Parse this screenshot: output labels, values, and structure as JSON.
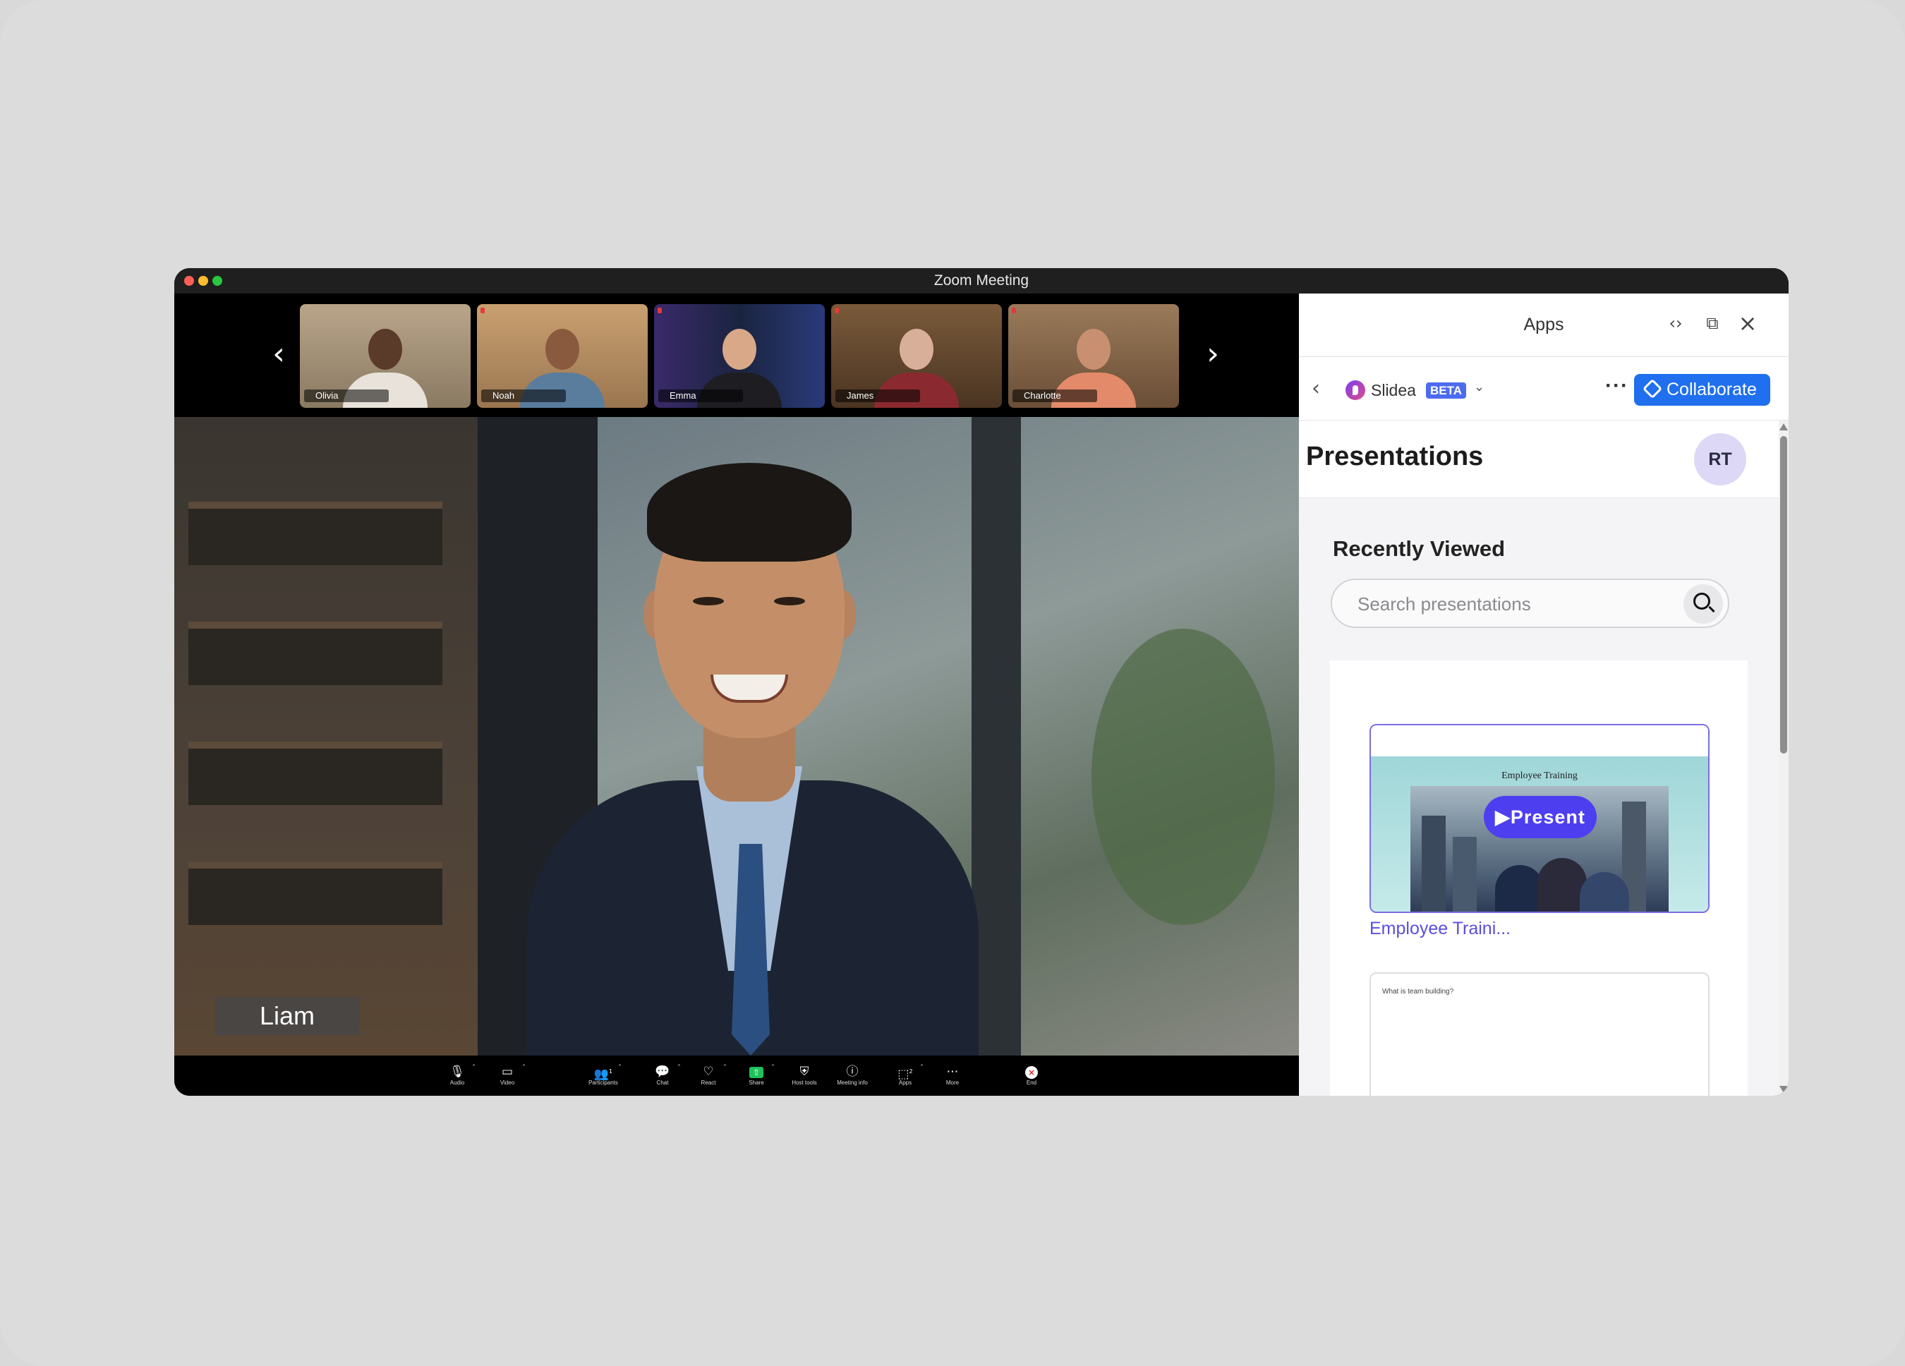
{
  "window": {
    "title": "Zoom Meeting"
  },
  "gallery": {
    "participants": [
      {
        "name": "Olivia"
      },
      {
        "name": "Noah"
      },
      {
        "name": "Emma"
      },
      {
        "name": "James"
      },
      {
        "name": "Charlotte"
      }
    ],
    "prev_icon": "chevron-left-icon",
    "next_icon": "chevron-right-icon"
  },
  "speaker": {
    "name": "Liam"
  },
  "toolbar": {
    "items": [
      {
        "label": "Audio",
        "icon": "microphone-icon"
      },
      {
        "label": "Video",
        "icon": "camera-icon"
      },
      {
        "label": "Participants",
        "icon": "participants-icon",
        "count": "1"
      },
      {
        "label": "Chat",
        "icon": "chat-icon"
      },
      {
        "label": "React",
        "icon": "heart-icon"
      },
      {
        "label": "Share",
        "icon": "share-icon"
      },
      {
        "label": "Host tools",
        "icon": "shield-icon"
      },
      {
        "label": "Meeting info",
        "icon": "info-icon"
      },
      {
        "label": "Apps",
        "icon": "apps-icon",
        "count": "2"
      },
      {
        "label": "More",
        "icon": "more-icon"
      },
      {
        "label": "End",
        "icon": "end-icon"
      }
    ],
    "colors": {
      "share": "#1fc35a",
      "end": "#e0282e"
    }
  },
  "apps_panel": {
    "title": "Apps",
    "app_name": "Slidea",
    "badge": "BETA",
    "collaborate_label": "Collaborate",
    "section_title": "Presentations",
    "avatar_initials": "RT",
    "recently_viewed": "Recently Viewed",
    "search": {
      "placeholder": "Search presentations",
      "value": ""
    },
    "presentations": [
      {
        "name": "Employee Traini...",
        "slide_title": "Employee Training",
        "action": "▶Present"
      },
      {
        "name": "",
        "slide_title": "What is team building?"
      }
    ],
    "colors": {
      "accent": "#1f6fee",
      "present": "#4d3ef0",
      "beta": "#4c6bf0"
    }
  }
}
